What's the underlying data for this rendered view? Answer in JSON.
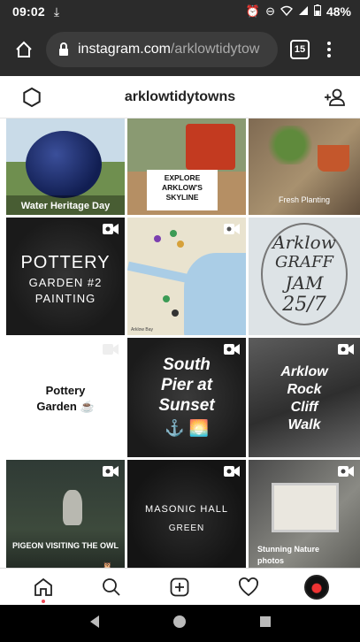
{
  "status_bar": {
    "time": "09:02",
    "battery": "48%"
  },
  "browser": {
    "url_domain": "instagram.com",
    "url_path": "/arklowtidytow",
    "tab_count": "15"
  },
  "profile": {
    "username": "arklowtidytowns"
  },
  "posts": [
    {
      "caption": "Water Heritage Day"
    },
    {
      "caption_lines": [
        "EXPLORE",
        "ARKLOW'S",
        "SKYLINE"
      ]
    },
    {
      "caption": "Fresh Planting"
    },
    {
      "caption_lines": [
        "POTTERY",
        "GARDEN #2",
        "PAINTING"
      ]
    },
    {
      "caption": "Arklow Bay"
    },
    {
      "caption_lines": [
        "Arklow",
        "GRAFF",
        "JAM",
        "25/7"
      ]
    },
    {
      "caption_lines": [
        "Pottery",
        "Garden ☕"
      ]
    },
    {
      "caption_lines": [
        "South",
        "Pier at",
        "Sunset"
      ]
    },
    {
      "caption_lines": [
        "Arklow",
        "Rock",
        "Cliff",
        "Walk"
      ]
    },
    {
      "caption": "PIGEON VISITING THE OWL"
    },
    {
      "caption_lines": [
        "MASONIC HALL",
        "GREEN"
      ]
    },
    {
      "caption_lines": [
        "Stunning Nature",
        "photos"
      ]
    }
  ],
  "colors": {
    "browser_bar": "#2b2b2b",
    "nav_dot": "#ed4956"
  }
}
